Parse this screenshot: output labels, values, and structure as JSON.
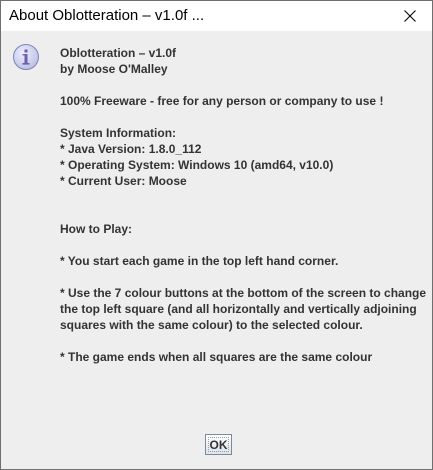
{
  "window": {
    "title": "About Oblotteration – v1.0f ..."
  },
  "dialog": {
    "icon": "info-icon",
    "lines": [
      "Oblotteration – v1.0f",
      "by Moose O'Malley",
      "",
      "100% Freeware - free for any person or company to use !",
      "",
      "System Information:",
      "* Java Version: 1.8.0_112",
      "* Operating System: Windows 10 (amd64, v10.0)",
      "* Current User: Moose",
      "",
      "",
      "How to Play:",
      "",
      "* You start each game in the top left hand corner.",
      "",
      "* Use the 7 colour buttons at the bottom of the screen to change",
      "the top left square (and all horizontally and vertically adjoining",
      "squares with the same colour) to the selected colour.",
      "",
      "* The game ends when all squares are the same colour"
    ],
    "ok_label": "OK"
  },
  "colors": {
    "background": "#eeeeee",
    "text": "#333333",
    "icon_fill": "#c8cbe8",
    "icon_border": "#7e83b8"
  }
}
